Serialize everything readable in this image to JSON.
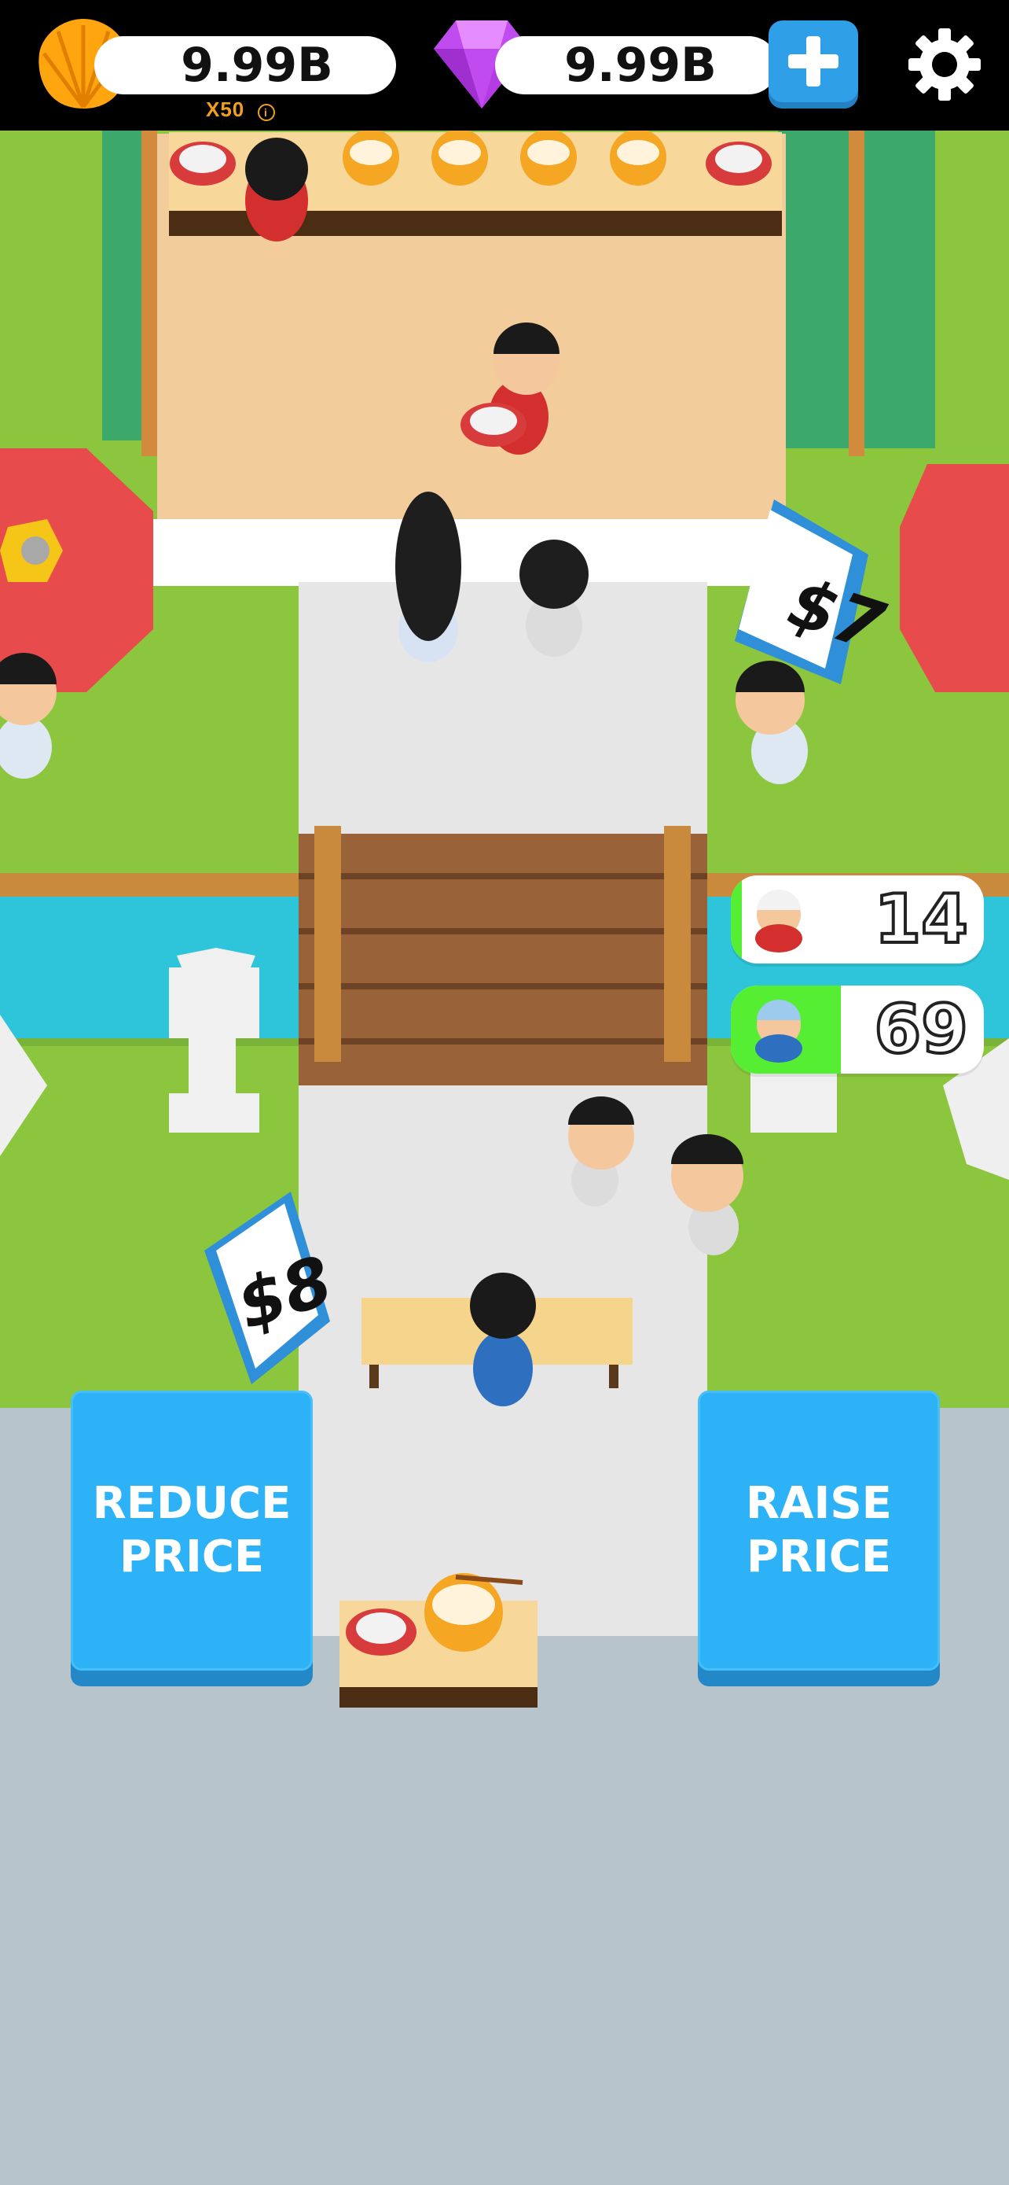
{
  "hud": {
    "coins": "9.99B",
    "multiplier": "X50",
    "multiplier_info_icon": "info-icon",
    "gems": "9.99B",
    "add_gems_icon": "plus-icon",
    "settings_icon": "gear-icon"
  },
  "signs": {
    "upper_price": "$7",
    "lower_price": "$8"
  },
  "counters": [
    {
      "label": "red-customer-count",
      "value": "14",
      "fill_color": "#55ee33"
    },
    {
      "label": "blue-customer-count",
      "value": "69",
      "fill_color": "#55ee33"
    }
  ],
  "buttons": {
    "reduce": "REDUCE\nPRICE",
    "raise": "RAISE\nPRICE"
  },
  "colors": {
    "button_blue": "#2db2f7",
    "grass": "#8cc63f",
    "path": "#e6e6e6",
    "gem": "#c04cf0",
    "coin": "#ffa50f"
  }
}
